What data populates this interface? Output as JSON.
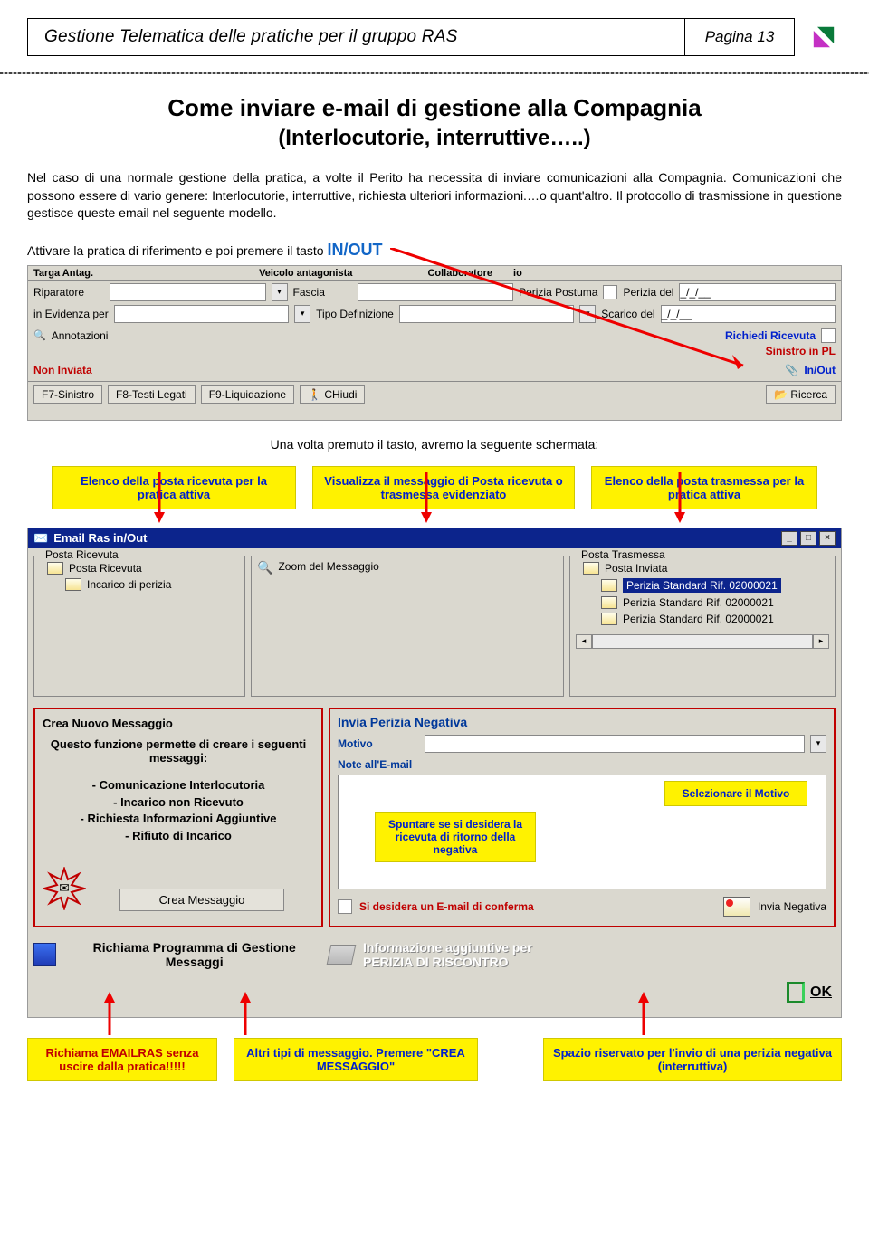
{
  "header": {
    "title": "Gestione Telematica delle pratiche per il gruppo RAS",
    "page": "Pagina 13"
  },
  "main_title": "Come inviare e-mail di gestione alla Compagnia",
  "main_sub": "(Interlocutorie, interruttive…..)",
  "body_para": "Nel caso di una normale gestione della pratica, a volte il Perito ha necessita di inviare comunicazioni alla  Compagnia. Comunicazioni che possono essere di vario genere: Interlocutorie, interruttive, richiesta ulteriori informazioni.…o quant'altro. Il protocollo di trasmissione in questione gestisce queste email nel seguente modello.",
  "activate_prefix": "Attivare la pratica di riferimento e poi premere il tasto ",
  "activate_key": "IN/OUT",
  "shot1": {
    "top_labels": {
      "targa": "Targa Antag.",
      "veicolo": "Veicolo antagonista",
      "collab": "Collaboratore",
      "io": "io"
    },
    "row1": {
      "riparatore": "Riparatore",
      "fascia": "Fascia",
      "perizia_post": "Perizia Postuma",
      "perizia_del": "Perizia del",
      "date_sep": "_/_/__"
    },
    "row2": {
      "evidenza": "in Evidenza per",
      "tipo_def": "Tipo Definizione",
      "scarico": "Scarico del",
      "date_sep": "_/_/__"
    },
    "row3": {
      "annot": "Annotazioni",
      "rich_ric": "Richiedi Ricevuta",
      "sin_pl": "Sinistro in PL"
    },
    "row4": {
      "non_inv": "Non Inviata",
      "inout": "In/Out"
    },
    "btns": {
      "f7": "F7-Sinistro",
      "f8": "F8-Testi Legati",
      "f9": "F9-Liquidazione",
      "chiudi": "CHiudi",
      "ricerca": "Ricerca"
    }
  },
  "caption_after": "Una volta premuto il tasto, avremo la seguente schermata:",
  "callouts": {
    "c1": "Elenco della posta ricevuta per la pratica attiva",
    "c2": "Visualizza il messaggio di Posta ricevuta o trasmessa evidenziato",
    "c3": "Elenco della posta trasmessa per la pratica attiva"
  },
  "shot2": {
    "title": "Email Ras in/Out",
    "posta_ric_title": "Posta Ricevuta",
    "posta_ric_root": "Posta Ricevuta",
    "posta_ric_item": "Incarico di perizia",
    "zoom_title": "Zoom del Messaggio",
    "posta_tras_title": "Posta Trasmessa",
    "posta_tras_root": "Posta Inviata",
    "posta_tras_sel": "Perizia Standard Rif. 02000021",
    "posta_tras_i2": "Perizia Standard Rif. 02000021",
    "posta_tras_i3": "Perizia Standard Rif. 02000021"
  },
  "crea": {
    "title": "Crea Nuovo Messaggio",
    "desc": "Questo funzione permette di creare i seguenti messaggi:",
    "l1": "- Comunicazione Interlocutoria",
    "l2": "- Incarico non Ricevuto",
    "l3": "- Richiesta Informazioni Aggiuntive",
    "l4": "- Rifiuto di Incarico",
    "btn": "Crea Messaggio"
  },
  "neg": {
    "title": "Invia Perizia Negativa",
    "motivo": "Motivo",
    "note": "Note all'E-mail",
    "confirm": "Si desidera un E-mail di conferma",
    "invia": "Invia Negativa"
  },
  "below": {
    "richiama": "Richiama Programma di Gestione Messaggi",
    "agg1": "Informazione aggiuntive per",
    "agg2": "PERIZIA DI RISCONTRO",
    "ok": "OK"
  },
  "abs_callouts": {
    "spuntare": "Spuntare se si desidera la ricevuta di ritorno della negativa",
    "motivo": "Selezionare il Motivo"
  },
  "legend": {
    "l1": "Richiama EMAILRAS senza uscire dalla pratica!!!!!",
    "l2": "Altri tipi di messaggio. Premere \"CREA MESSAGGIO\"",
    "l3": "Spazio riservato per l'invio di una perizia negativa (interruttiva)"
  }
}
